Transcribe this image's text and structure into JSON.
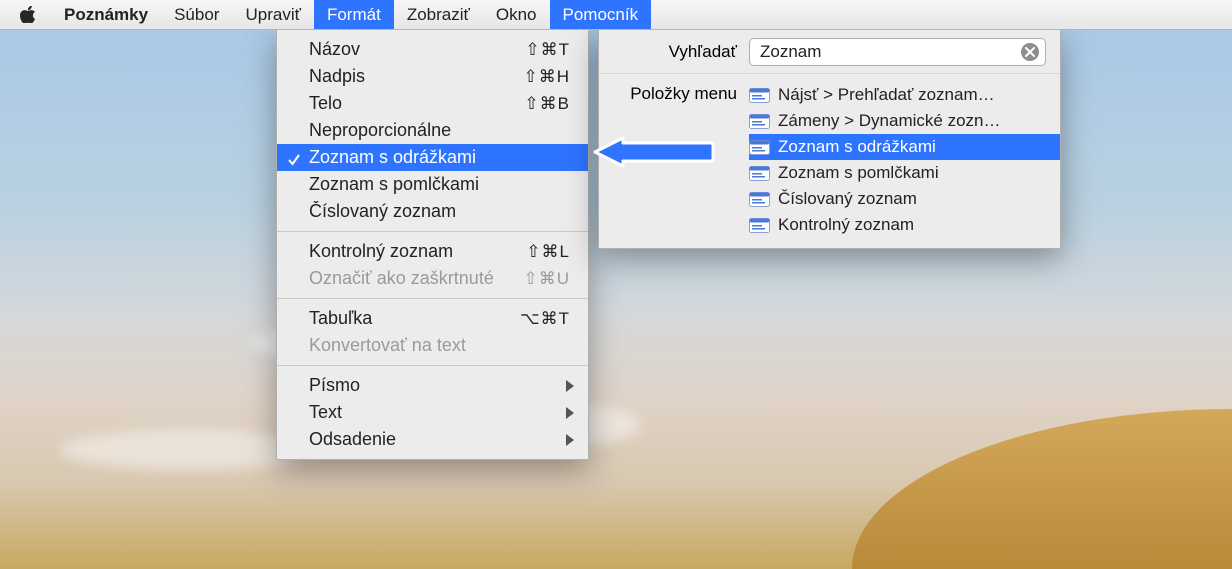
{
  "menubar": {
    "app": "Poznámky",
    "items": [
      "Súbor",
      "Upraviť",
      "Formát",
      "Zobraziť",
      "Okno",
      "Pomocník"
    ],
    "selected": [
      "Formát",
      "Pomocník"
    ]
  },
  "format_menu": {
    "groups": [
      [
        {
          "label": "Názov",
          "shortcut": "⇧⌘T"
        },
        {
          "label": "Nadpis",
          "shortcut": "⇧⌘H"
        },
        {
          "label": "Telo",
          "shortcut": "⇧⌘B"
        },
        {
          "label": "Neproporcionálne"
        },
        {
          "label": "Zoznam s odrážkami",
          "checked": true,
          "selected": true
        },
        {
          "label": "Zoznam s pomlčkami"
        },
        {
          "label": "Číslovaný zoznam"
        }
      ],
      [
        {
          "label": "Kontrolný zoznam",
          "shortcut": "⇧⌘L"
        },
        {
          "label": "Označiť ako zaškrtnuté",
          "shortcut": "⇧⌘U",
          "disabled": true
        }
      ],
      [
        {
          "label": "Tabuľka",
          "shortcut": "⌥⌘T"
        },
        {
          "label": "Konvertovať na text",
          "disabled": true
        }
      ],
      [
        {
          "label": "Písmo",
          "submenu": true
        },
        {
          "label": "Text",
          "submenu": true
        },
        {
          "label": "Odsadenie",
          "submenu": true
        }
      ]
    ]
  },
  "help_panel": {
    "search_label": "Vyhľadať",
    "search_value": "Zoznam",
    "results_label": "Položky menu",
    "results": [
      {
        "label": "Nájsť > Prehľadať zoznam…"
      },
      {
        "label": "Zámeny > Dynamické zozn…"
      },
      {
        "label": "Zoznam s odrážkami",
        "selected": true
      },
      {
        "label": "Zoznam s pomlčkami"
      },
      {
        "label": "Číslovaný zoznam"
      },
      {
        "label": "Kontrolný zoznam"
      }
    ]
  }
}
